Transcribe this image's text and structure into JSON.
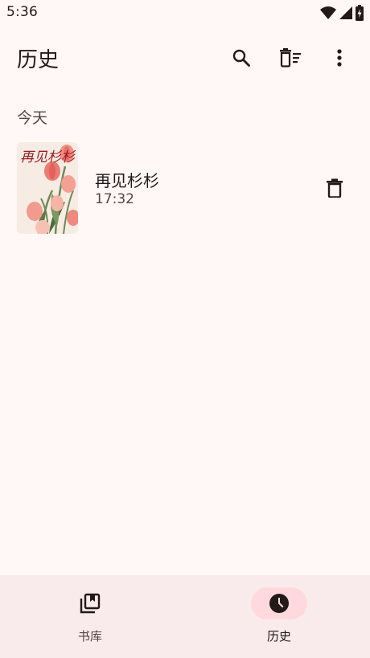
{
  "status_bar": {
    "time": "5:36",
    "icons": [
      "wifi-icon",
      "signal-icon",
      "battery-icon"
    ]
  },
  "app_bar": {
    "title": "历史",
    "actions": [
      "search-icon",
      "clear-history-icon",
      "more-vert-icon"
    ]
  },
  "sections": [
    {
      "header": "今天",
      "items": [
        {
          "title": "再见杉杉",
          "time": "17:32",
          "cover_text": "再见杉杉"
        }
      ]
    }
  ],
  "bottom_nav": {
    "items": [
      {
        "label": "书库",
        "icon": "library-books-icon",
        "selected": false
      },
      {
        "label": "历史",
        "icon": "history-clock-icon",
        "selected": true
      }
    ]
  },
  "colors": {
    "background": "#fff8f7",
    "nav_background": "#f9ebeb",
    "nav_indicator": "#ffd9dc",
    "text_primary": "#231919",
    "text_secondary": "#534343"
  }
}
